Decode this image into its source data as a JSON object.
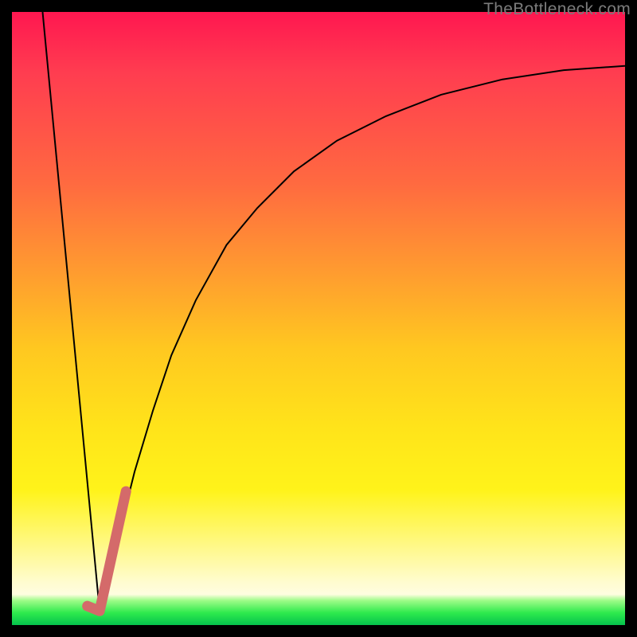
{
  "watermark": "TheBottleneck.com",
  "chart_data": {
    "type": "line",
    "title": "",
    "xlabel": "",
    "ylabel": "",
    "xlim": [
      0,
      100
    ],
    "ylim": [
      0,
      100
    ],
    "grid": false,
    "legend": false,
    "note": "Axes have no visible tick labels; x/y are normalized 0–100. Background is a vertical heat gradient red→yellow→green.",
    "series": [
      {
        "name": "left-descent",
        "stroke": "#000000",
        "stroke_width": 2,
        "x": [
          5,
          14.3
        ],
        "y": [
          100,
          2.3
        ]
      },
      {
        "name": "right-asymptote",
        "stroke": "#000000",
        "stroke_width": 2,
        "x": [
          14.3,
          16,
          18,
          20,
          23,
          26,
          30,
          35,
          40,
          46,
          53,
          61,
          70,
          80,
          90,
          100
        ],
        "y": [
          2.3,
          9,
          17,
          25,
          35,
          44,
          53,
          62,
          68,
          74,
          79,
          83,
          86.5,
          89,
          90.5,
          91.2
        ]
      },
      {
        "name": "highlight-j",
        "stroke": "#d46a6a",
        "stroke_width": 13,
        "linecap": "round",
        "x": [
          12.3,
          14.3,
          18.6
        ],
        "y": [
          3.1,
          2.3,
          21.8
        ]
      }
    ],
    "gradient_stops": [
      {
        "pos": 0.0,
        "color": "#ff1750"
      },
      {
        "pos": 0.1,
        "color": "#ff3d50"
      },
      {
        "pos": 0.28,
        "color": "#ff6a40"
      },
      {
        "pos": 0.42,
        "color": "#ff9a30"
      },
      {
        "pos": 0.55,
        "color": "#ffc820"
      },
      {
        "pos": 0.68,
        "color": "#ffe41a"
      },
      {
        "pos": 0.78,
        "color": "#fff31a"
      },
      {
        "pos": 0.93,
        "color": "#fffccf"
      },
      {
        "pos": 0.95,
        "color": "#fffde0"
      },
      {
        "pos": 0.96,
        "color": "#9efc88"
      },
      {
        "pos": 0.98,
        "color": "#2eea4d"
      },
      {
        "pos": 1.0,
        "color": "#05c34d"
      }
    ]
  }
}
